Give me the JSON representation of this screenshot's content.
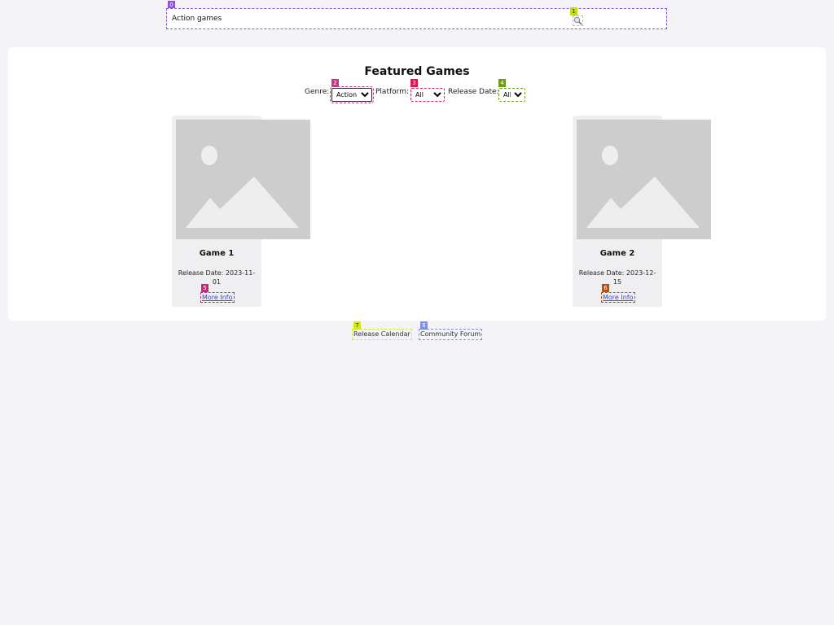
{
  "search": {
    "value": "Action games",
    "icon": "search-icon"
  },
  "main": {
    "title": "Featured Games",
    "filters": {
      "genre_label": "Genre:",
      "genre_value": "Action",
      "platform_label": "Platform:",
      "platform_value": "All",
      "release_label": "Release Date:",
      "release_value": "All"
    },
    "games": [
      {
        "title": "Game 1",
        "release": "Release Date: 2023-11-01",
        "link": "More Info"
      },
      {
        "title": "Game 2",
        "release": "Release Date: 2023-12-15",
        "link": "More Info"
      }
    ]
  },
  "footer": {
    "links": [
      "Release Calendar",
      "Community Forum"
    ]
  },
  "markers": [
    "0",
    "1",
    "2",
    "3",
    "4",
    "5",
    "6",
    "7",
    "8"
  ],
  "colors": {
    "marker0": "#8a55d8",
    "marker1": "#c5da12",
    "marker2": "#c2378a",
    "marker3": "#d81b4f",
    "marker4": "#6e9a1c",
    "marker5": "#c8287c",
    "marker6": "#b8520e",
    "marker7": "#d6e81a",
    "marker8": "#7e8fdc",
    "page_bg": "#f3f3f8",
    "link": "#4040d0"
  }
}
